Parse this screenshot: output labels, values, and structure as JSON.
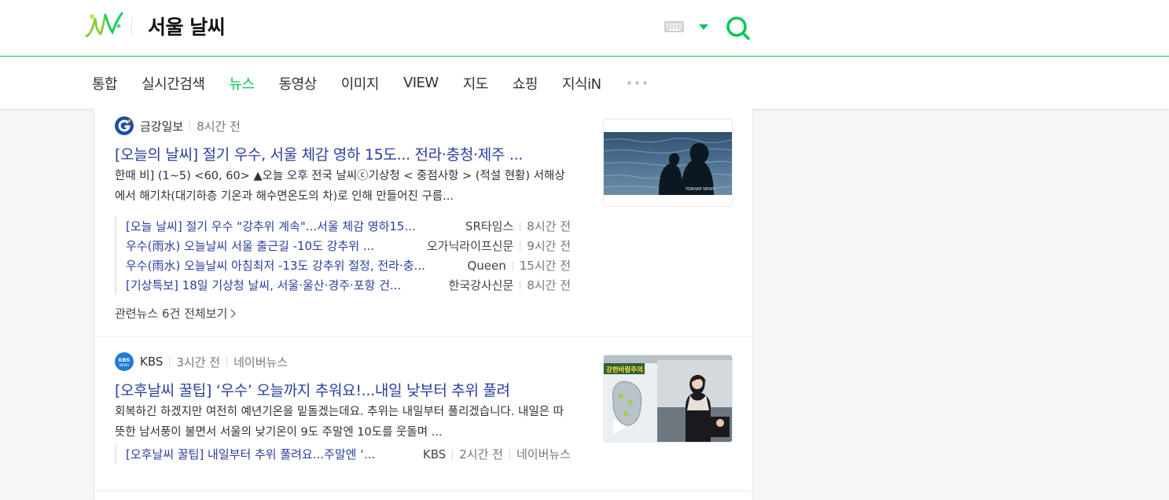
{
  "header": {
    "query": "서울 날씨"
  },
  "tabs": [
    "통합",
    "실시간검색",
    "뉴스",
    "동영상",
    "이미지",
    "VIEW",
    "지도",
    "쇼핑",
    "지식iN"
  ],
  "active_tab": "뉴스",
  "colors": {
    "accent": "#03c75a",
    "link": "#2a3f9b"
  },
  "news": [
    {
      "press": "금강일보",
      "time": "8시간 전",
      "title": "[오늘의 날씨] 절기 우수, 서울 체감 영하 15도... 전라·충청·제주 ...",
      "desc": "한때 비] (1~5) <60, 60> ▲오늘 오후 전국 날씨ⓒ기상청 < 중점사항 > (적설 현황) 서해상에서 해기차(대기하층 기온과 해수면온도의 차)로 인해 만들어진 구름...",
      "related": [
        {
          "title": "[오늘 날씨] 절기 우수 \"강추위 계속\"...서울 체감 영하15...",
          "press": "SR타임스",
          "time": "8시간 전"
        },
        {
          "title": "우수(雨水) 오늘날씨 서울 출근길 -10도 강추위 ...",
          "press": "오가닉라이프신문",
          "time": "9시간 전"
        },
        {
          "title": "우수(雨水) 오늘날씨 아침최저 -13도 강추위 절정, 전라·충...",
          "press": "Queen",
          "time": "15시간 전"
        },
        {
          "title": "[기상특보] 18일 기상청 날씨, 서울·울산·경주·포항 건...",
          "press": "한국강사신문",
          "time": "8시간 전"
        }
      ],
      "related_all": "관련뉴스 6건 전체보기",
      "thumb_watermark": "YONHAP NEWS"
    },
    {
      "press": "KBS",
      "time": "3시간 전",
      "platform": "네이버뉴스",
      "title": "[오후날씨 꿀팁] ‘우수’ 오늘까지 추워요!...내일 낮부터 추위 풀려",
      "desc": "회복하긴 하겠지만 여전히 예년기온을 밑돌겠는데요. 추위는 내일부터 풀리겠습니다. 내일은 따뜻한 남서풍이 불면서 서울의 낮기온이 9도 주말엔 10도를 웃돌며 ...",
      "related": [
        {
          "title": "[오후날씨 꿀팁] 내일부터 추위 풀려요...주말엔 ‘...",
          "press": "KBS",
          "time": "2시간 전",
          "platform": "네이버뉴스"
        }
      ],
      "thumb_caption": "강한바람주의",
      "press_logo_text": "KBS NEWS"
    }
  ]
}
